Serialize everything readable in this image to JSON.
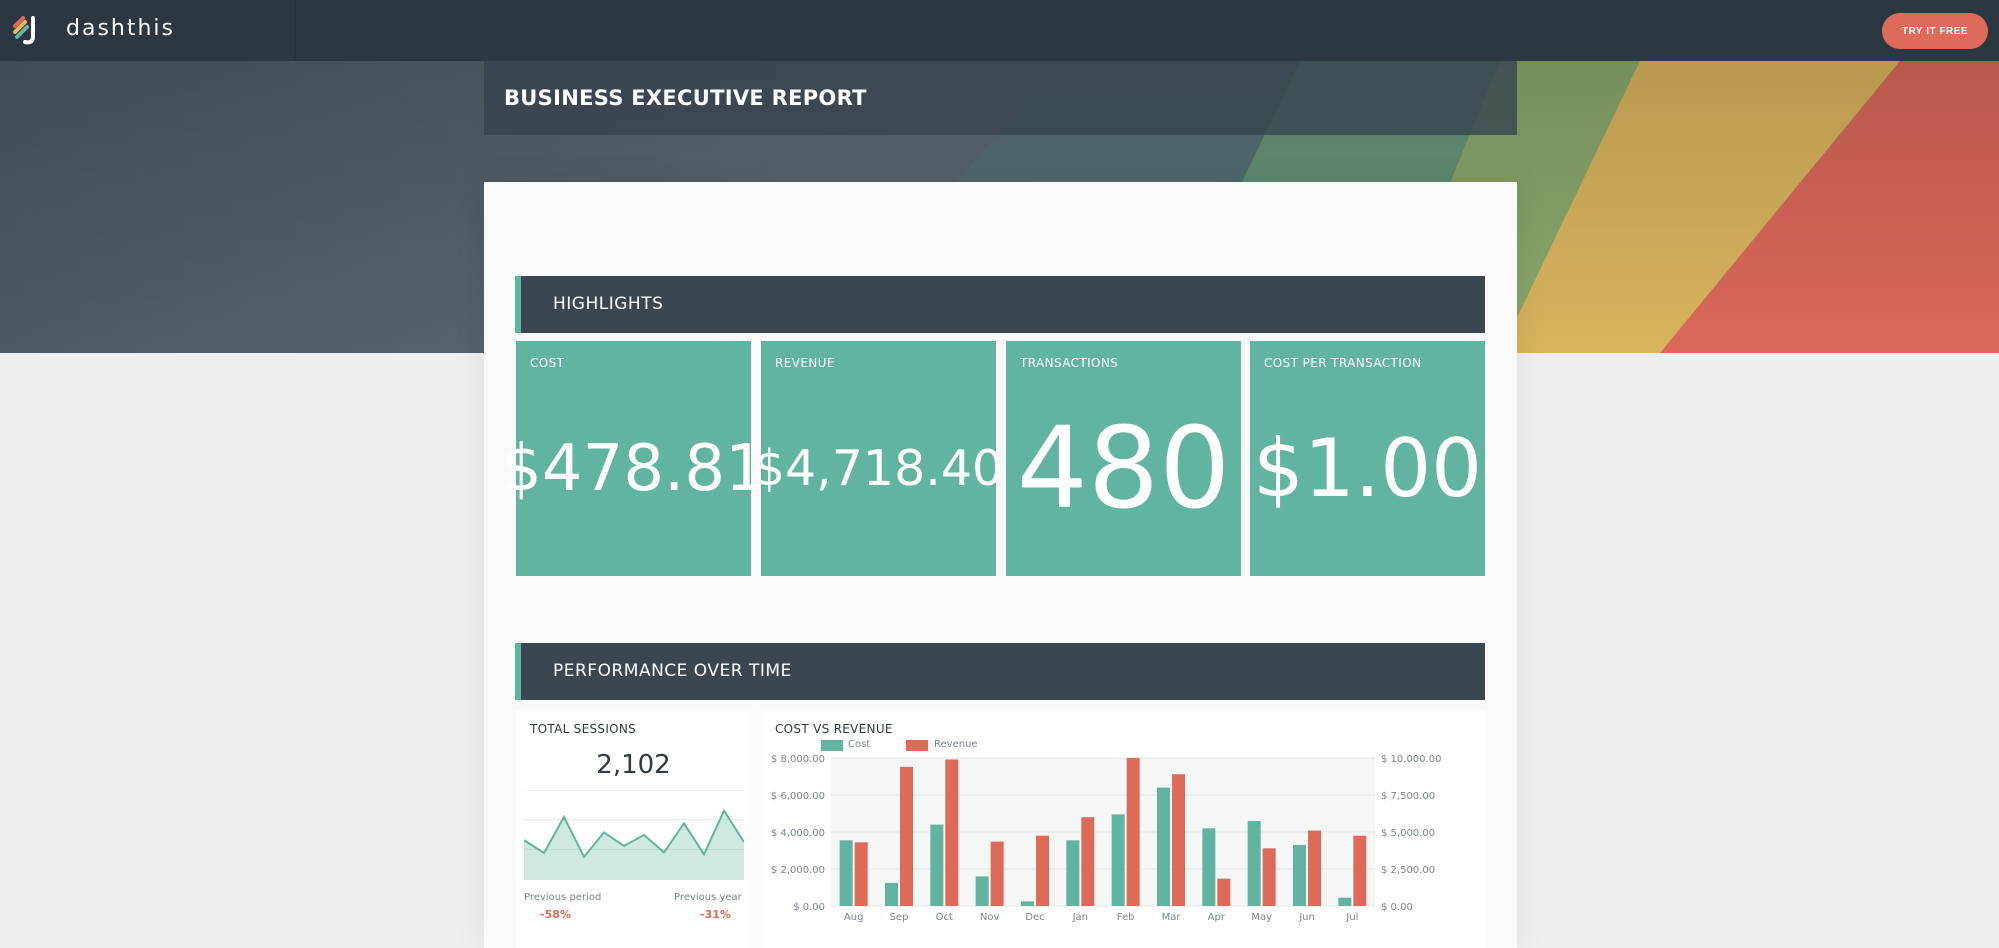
{
  "app": {
    "logo_text": "dashthis",
    "cta_label": "TRY IT FREE"
  },
  "report": {
    "title": "BUSINESS EXECUTIVE REPORT"
  },
  "sections": {
    "highlights": "HIGHLIGHTS",
    "performance": "PERFORMANCE OVER TIME"
  },
  "kpis": [
    {
      "label": "COST",
      "value": "$478.81"
    },
    {
      "label": "REVENUE",
      "value": "$4,718.40"
    },
    {
      "label": "TRANSACTIONS",
      "value": "480"
    },
    {
      "label": "COST PER TRANSACTION",
      "value": "$1.00"
    }
  ],
  "sessions": {
    "title": "TOTAL SESSIONS",
    "value": "2,102",
    "previous_period_label": "Previous period",
    "previous_period_pct": "-58%",
    "previous_year_label": "Previous year",
    "previous_year_pct": "-31%"
  },
  "colors": {
    "accent_teal": "#61b5a0",
    "accent_red": "#de6a5a",
    "header_dark": "#3a4751",
    "topbar": "#2c3841"
  },
  "chart_data": [
    {
      "type": "area",
      "title": "TOTAL SESSIONS",
      "values": [
        62,
        42,
        98,
        36,
        74,
        53,
        70,
        43,
        88,
        40,
        108,
        59
      ],
      "ylim": [
        0,
        140
      ],
      "grid": true
    },
    {
      "type": "bar",
      "title": "COST VS REVENUE",
      "categories": [
        "Aug",
        "Sep",
        "Oct",
        "Nov",
        "Dec",
        "Jan",
        "Feb",
        "Mar",
        "Apr",
        "May",
        "Jun",
        "Jul"
      ],
      "series": [
        {
          "name": "Cost",
          "axis": "left",
          "color": "#61b5a0",
          "values": [
            3550,
            1250,
            4400,
            1600,
            250,
            3550,
            4950,
            6400,
            4200,
            4600,
            3300,
            450
          ]
        },
        {
          "name": "Revenue",
          "axis": "right",
          "color": "#de6a5a",
          "values": [
            4300,
            9400,
            9900,
            4350,
            4750,
            6000,
            10000,
            8900,
            1850,
            3900,
            5100,
            4750
          ]
        }
      ],
      "y_left": {
        "ylim": [
          0,
          8000
        ],
        "ticks": [
          "$ 0.00",
          "$ 2,000.00",
          "$ 4,000.00",
          "$ 6,000.00",
          "$ 8,000.00"
        ]
      },
      "y_right": {
        "ylim": [
          0,
          10000
        ],
        "ticks": [
          "$ 0.00",
          "$ 2,500.00",
          "$ 5,000.00",
          "$ 7,500.00",
          "$ 10,000.00"
        ]
      },
      "legend_placement": "top-left",
      "grid": true
    }
  ]
}
